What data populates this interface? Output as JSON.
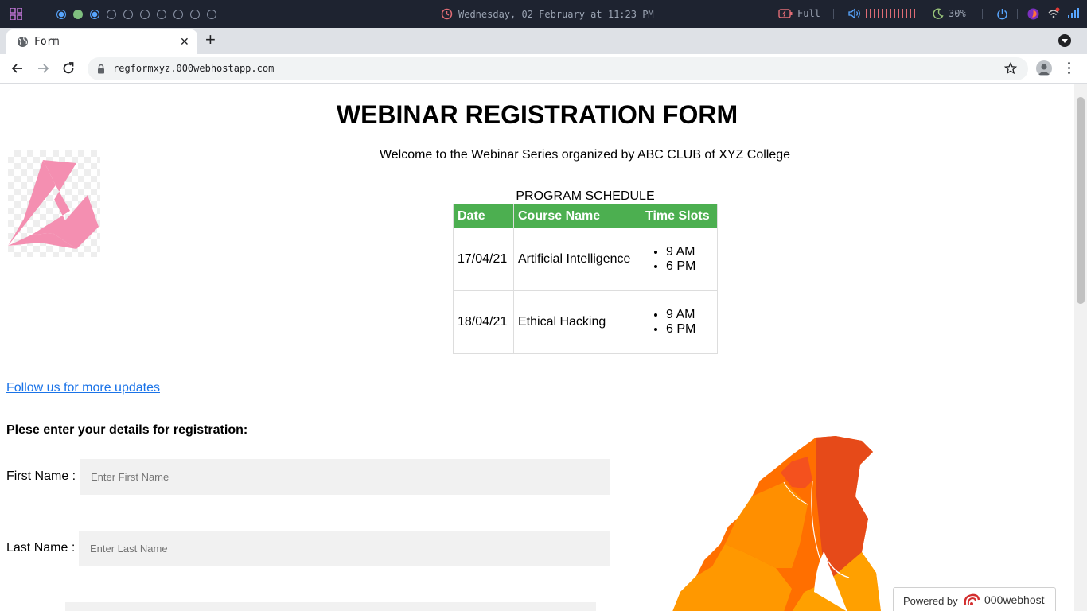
{
  "system_bar": {
    "datetime": "Wednesday, 02 February at 11:23 PM",
    "battery": "Full",
    "brightness": "30%"
  },
  "browser": {
    "tab_title": "Form",
    "url": "regformxyz.000webhostapp.com"
  },
  "page": {
    "title": "WEBINAR REGISTRATION FORM",
    "welcome": "Welcome to the Webinar Series organized by ABC CLUB of XYZ College",
    "schedule_caption": "PROGRAM SCHEDULE",
    "schedule_headers": [
      "Date",
      "Course Name",
      "Time Slots"
    ],
    "schedule_rows": [
      {
        "date": "17/04/21",
        "course": "Artificial Intelligence",
        "slots": [
          "9 AM",
          "6 PM"
        ]
      },
      {
        "date": "18/04/21",
        "course": "Ethical Hacking",
        "slots": [
          "9 AM",
          "6 PM"
        ]
      }
    ],
    "follow_link": "Follow us for more updates",
    "registration_heading": "Plese enter your details for registration:",
    "first_name_label": "First Name :",
    "first_name_placeholder": "Enter First Name",
    "last_name_label": "Last Name :",
    "last_name_placeholder": "Enter Last Name",
    "powered_by": "Powered by",
    "powered_brand": "000webhost"
  },
  "colors": {
    "table_header": "#4caf50",
    "link": "#1a73e8",
    "logo_pink": "#f48fb1",
    "map_orange": "#ff6f00"
  }
}
